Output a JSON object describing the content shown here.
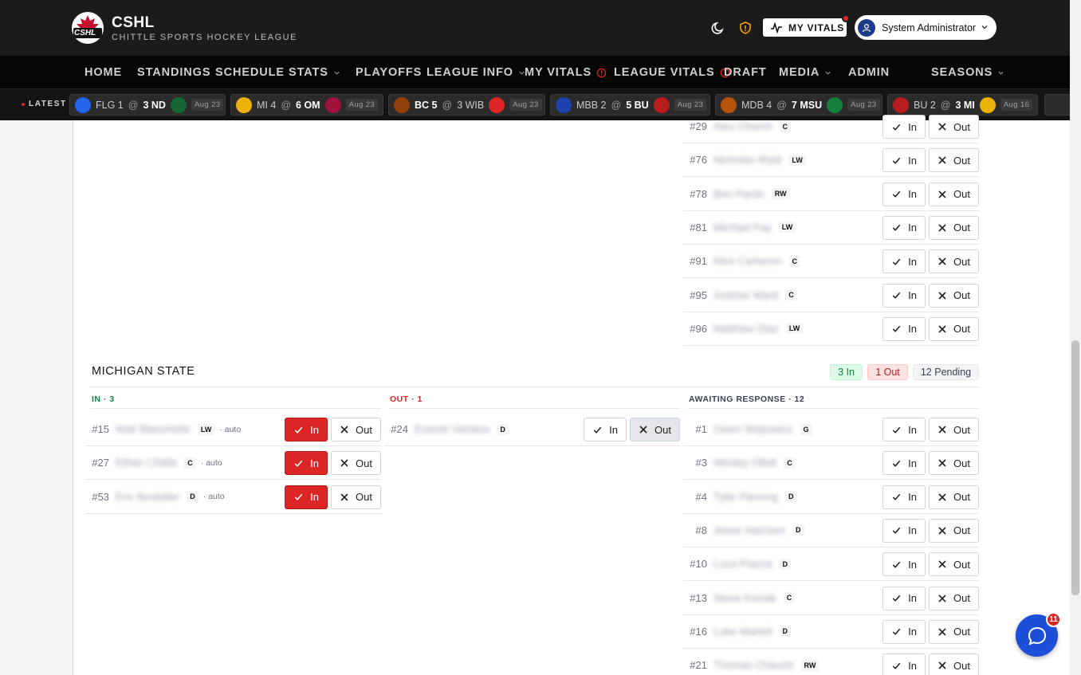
{
  "brand": {
    "name": "CSHL",
    "subtitle": "CHITTLE SPORTS HOCKEY LEAGUE",
    "logo_text": "CSHL"
  },
  "header": {
    "vitals_label": "MY VITALS",
    "user_name": "System Administrator"
  },
  "nav": [
    {
      "label": "HOME"
    },
    {
      "label": "STANDINGS"
    },
    {
      "label": "SCHEDULE"
    },
    {
      "label": "STATS"
    },
    {
      "label": "PLAYOFFS"
    },
    {
      "label": "LEAGUE INFO"
    },
    {
      "label": "MY VITALS"
    },
    {
      "label": "LEAGUE VITALS"
    },
    {
      "label": "DRAFT"
    },
    {
      "label": "MEDIA"
    },
    {
      "label": "ADMIN"
    },
    {
      "label": "SEASONS"
    }
  ],
  "ticker": {
    "label": "LATEST",
    "games": [
      {
        "away": "FLG 1",
        "home": "3 ND",
        "date": "Aug 23",
        "away_color": "#2563eb",
        "home_color": "#166534"
      },
      {
        "away": "MI 4",
        "home": "6 OM",
        "date": "Aug 23",
        "away_color": "#eab308",
        "home_color": "#9f1239"
      },
      {
        "away": "BC 5",
        "home": "3 WIB",
        "date": "Aug 23",
        "away_color": "#92400e",
        "home_color": "#dc2626"
      },
      {
        "away": "MBB 2",
        "home": "5 BU",
        "date": "Aug 23",
        "away_color": "#1e40af",
        "home_color": "#b91c1c"
      },
      {
        "away": "MDB 4",
        "home": "7 MSU",
        "date": "Aug 23",
        "away_color": "#b45309",
        "home_color": "#15803d"
      },
      {
        "away": "BU 2",
        "home": "3 MI",
        "date": "Aug 16",
        "away_color": "#b91c1c",
        "home_color": "#eab308"
      }
    ],
    "at": "@"
  },
  "buttons": {
    "in": "In",
    "out": "Out"
  },
  "prev_team_pending": [
    {
      "num": "#29",
      "name": "Alex Church",
      "pos": "C"
    },
    {
      "num": "#76",
      "name": "Nicholas Wyld",
      "pos": "LW"
    },
    {
      "num": "#78",
      "name": "Ben Pardo",
      "pos": "RW"
    },
    {
      "num": "#81",
      "name": "Michael Fay",
      "pos": "LW"
    },
    {
      "num": "#91",
      "name": "Nick Cameron",
      "pos": "C"
    },
    {
      "num": "#95",
      "name": "Andrew Ward",
      "pos": "C"
    },
    {
      "num": "#96",
      "name": "Matthew Diaz",
      "pos": "LW"
    }
  ],
  "team": {
    "name": "MICHIGAN STATE",
    "counts": {
      "in": "3 In",
      "out": "1 Out",
      "pending": "12 Pending"
    },
    "headers": {
      "in": "IN · 3",
      "out": "OUT · 1",
      "pending": "AWAITING RESPONSE · 12"
    },
    "auto_label": "· auto",
    "in_players": [
      {
        "num": "#15",
        "name": "Matt Blanchette",
        "pos": "LW"
      },
      {
        "num": "#27",
        "name": "Ethan Chittle",
        "pos": "C"
      },
      {
        "num": "#53",
        "name": "Eric Boutelier",
        "pos": "D"
      }
    ],
    "out_players": [
      {
        "num": "#24",
        "name": "Everett Vanlaos",
        "pos": "D"
      }
    ],
    "pending_players": [
      {
        "num": "#1",
        "name": "Owen Wojtowicz",
        "pos": "G"
      },
      {
        "num": "#3",
        "name": "Wesley Ollett",
        "pos": "C"
      },
      {
        "num": "#4",
        "name": "Tyler Fleming",
        "pos": "D"
      },
      {
        "num": "#8",
        "name": "Jesse Harrison",
        "pos": "D"
      },
      {
        "num": "#10",
        "name": "Luca Piazza",
        "pos": "D"
      },
      {
        "num": "#13",
        "name": "Steve Kociak",
        "pos": "C"
      },
      {
        "num": "#16",
        "name": "Luke Martell",
        "pos": "D"
      },
      {
        "num": "#21",
        "name": "Thomas Chauret",
        "pos": "RW"
      }
    ]
  },
  "chat": {
    "badge": "11"
  },
  "colors": {
    "accent_red": "#dc2626",
    "in_green": "#15803d",
    "out_red": "#dc2626"
  }
}
